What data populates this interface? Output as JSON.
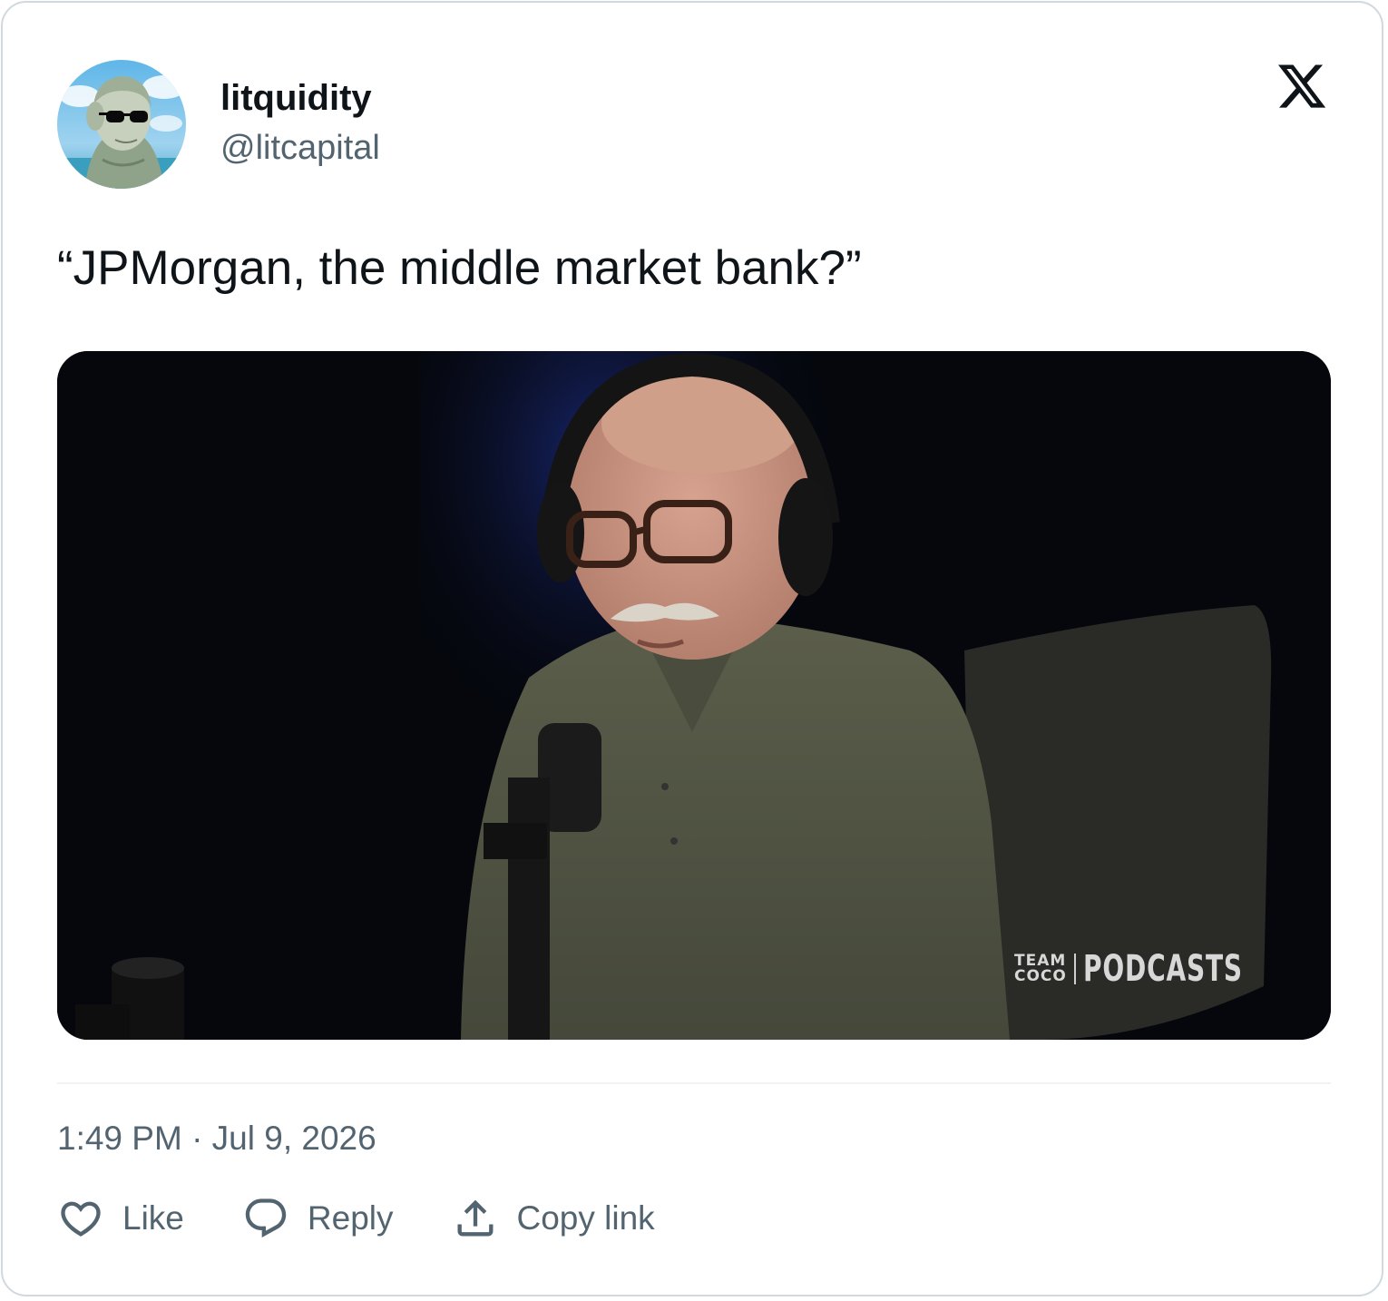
{
  "author": {
    "display_name": "litquidity",
    "handle": "@litcapital",
    "avatar_icon": "avatar-cartoon-with-sunglasses"
  },
  "platform_logo": "x-logo-icon",
  "tweet": {
    "text": "“JPMorgan, the middle market bank?”",
    "media": {
      "type": "video-still",
      "watermark_small_top": "TEAM",
      "watermark_small_bottom": "COCO",
      "watermark_large": "PODCASTS"
    },
    "timestamp": "1:49 PM · Jul 9, 2026"
  },
  "actions": {
    "like_label": "Like",
    "reply_label": "Reply",
    "copy_label": "Copy link"
  },
  "colors": {
    "text_primary": "#0f1419",
    "text_secondary": "#536471",
    "border": "#cfd9de",
    "divider": "#eff3f4"
  }
}
